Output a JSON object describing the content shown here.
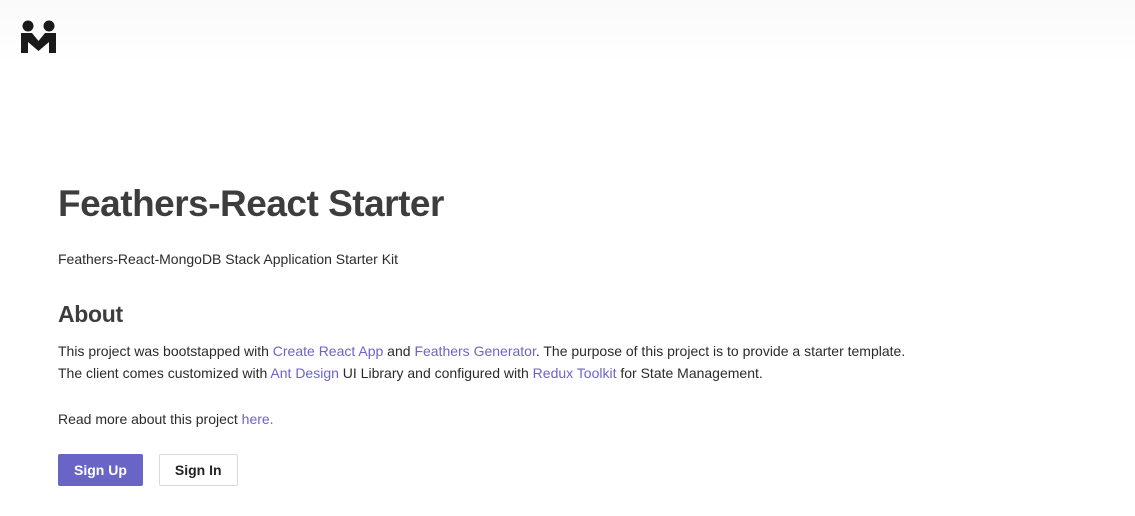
{
  "header": {
    "logo_icon": "mongodb-m-logo-icon"
  },
  "main": {
    "title": "Feathers-React Starter",
    "subtitle": "Feathers-React-MongoDB Stack Application Starter Kit",
    "about_heading": "About",
    "about_line1": {
      "t1": "This project was bootstapped with ",
      "link1": "Create React App",
      "t2": " and ",
      "link2": "Feathers Generator",
      "t3": ". The purpose of this project is to provide a starter template."
    },
    "about_line2": {
      "t1": "The client comes customized with ",
      "link1": "Ant Design",
      "t2": " UI Library and configured with ",
      "link2": "Redux Toolkit",
      "t3": " for State Management."
    },
    "read_more": {
      "text": "Read more about this project ",
      "link": "here."
    },
    "buttons": {
      "sign_up": "Sign Up",
      "sign_in": "Sign In"
    }
  },
  "colors": {
    "link": "#6a65c9",
    "primary_button": "#6865c6",
    "heading": "#3d3d3d"
  }
}
